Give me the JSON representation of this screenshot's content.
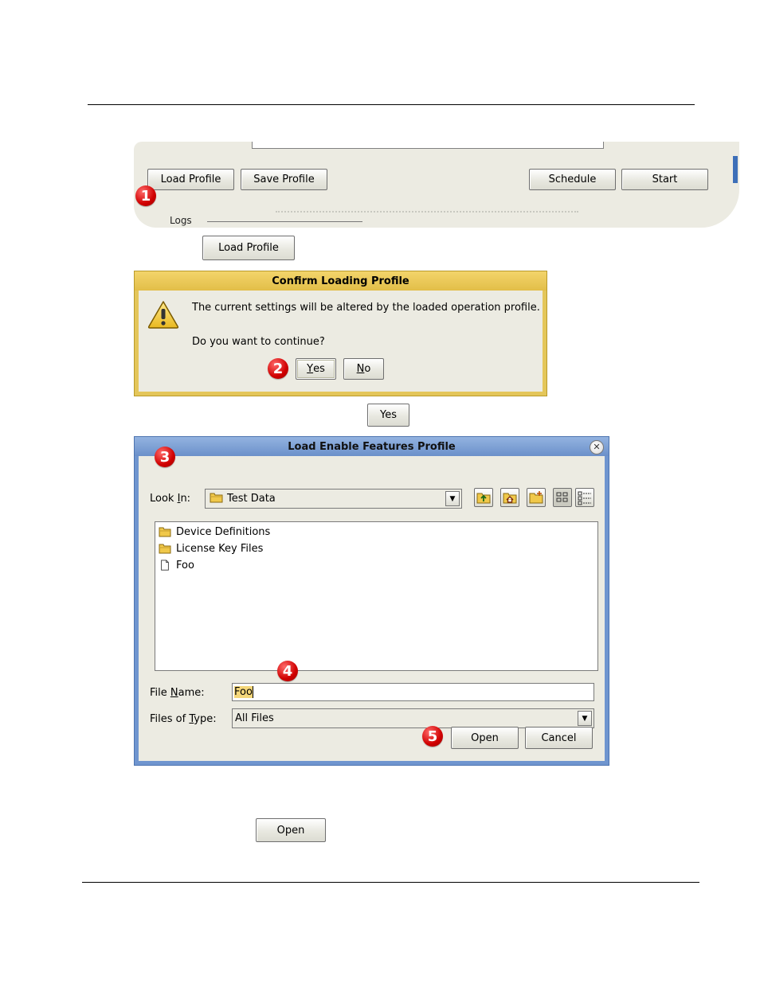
{
  "toolbar_panel": {
    "load_profile": "Load Profile",
    "save_profile": "Save Profile",
    "schedule": "Schedule",
    "start": "Start",
    "logs_label": "Logs"
  },
  "step_badges": [
    "1",
    "2",
    "3",
    "4",
    "5"
  ],
  "inline_buttons": {
    "load_profile": "Load Profile",
    "yes": "Yes",
    "open": "Open"
  },
  "confirm_dialog": {
    "title": "Confirm Loading Profile",
    "message": "The current settings will be altered by the loaded operation profile.",
    "question": "Do you want to continue?",
    "yes_mnemonic": "Y",
    "yes_rest": "es",
    "no_mnemonic": "N",
    "no_rest": "o",
    "icon": "warning-icon"
  },
  "file_dialog": {
    "title": "Load Enable Features Profile",
    "look_in_label_pre": "Look ",
    "look_in_label_mn": "I",
    "look_in_label_post": "n:",
    "look_in_value": "Test Data",
    "items": [
      {
        "name": "Device Definitions",
        "type": "folder"
      },
      {
        "name": "License Key Files",
        "type": "folder"
      },
      {
        "name": "Foo",
        "type": "file"
      }
    ],
    "file_name_label_pre": "File ",
    "file_name_label_mn": "N",
    "file_name_label_post": "ame:",
    "file_name_value": "Foo",
    "files_of_type_label_pre": "Files of ",
    "files_of_type_label_mn": "T",
    "files_of_type_label_post": "ype:",
    "files_of_type_value": "All Files",
    "open": "Open",
    "cancel": "Cancel",
    "toolbar_icons": [
      "up-folder-icon",
      "home-icon",
      "new-folder-icon",
      "list-view-icon",
      "details-view-icon"
    ]
  },
  "colors": {
    "confirm_border": "#e4c65a",
    "file_dialog_border": "#6f95cf",
    "badge": "#d00000",
    "panel_bg": "#ecebe2"
  }
}
